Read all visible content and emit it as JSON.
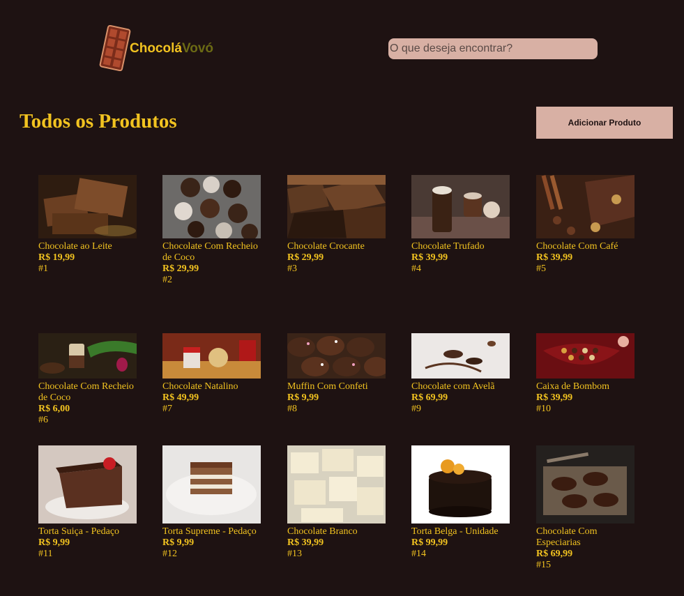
{
  "header": {
    "brand_part1": "Chocolá",
    "brand_part2": "Vovó",
    "search_placeholder": "O que deseja encontrar?"
  },
  "main": {
    "title": "Todos os Produtos",
    "add_button": "Adicionar Produto"
  },
  "products": [
    {
      "name": "Chocolate ao Leite",
      "price": "R$ 19,99",
      "id": "#1"
    },
    {
      "name": "Chocolate Com Recheio de Coco",
      "price": "R$ 29,99",
      "id": "#2"
    },
    {
      "name": "Chocolate Crocante",
      "price": "R$ 29,99",
      "id": "#3"
    },
    {
      "name": "Chocolate Trufado",
      "price": "R$ 39,99",
      "id": "#4"
    },
    {
      "name": "Chocolate Com Café",
      "price": "R$ 39,99",
      "id": "#5"
    },
    {
      "name": "Chocolate Com Recheio de Coco",
      "price": "R$ 6,00",
      "id": "#6"
    },
    {
      "name": "Chocolate Natalino",
      "price": "R$ 49,99",
      "id": "#7"
    },
    {
      "name": "Muffin Com Confeti",
      "price": "R$ 9,99",
      "id": "#8"
    },
    {
      "name": "Chocolate com Avelã",
      "price": "R$ 69,99",
      "id": "#9"
    },
    {
      "name": "Caixa de Bombom",
      "price": "R$ 39,99",
      "id": "#10"
    },
    {
      "name": "Torta Suiça - Pedaço",
      "price": "R$ 9,99",
      "id": "#11"
    },
    {
      "name": "Torta Supreme - Pedaço",
      "price": "R$ 9,99",
      "id": "#12"
    },
    {
      "name": "Chocolate Branco",
      "price": "R$ 39,99",
      "id": "#13"
    },
    {
      "name": "Torta Belga - Unidade",
      "price": "R$ 99,99",
      "id": "#14"
    },
    {
      "name": "Chocolate Com Especiarias",
      "price": "R$ 69,99",
      "id": "#15"
    }
  ],
  "colors": {
    "background": "#1e1212",
    "accent": "#f2c320",
    "button": "#d8b0a4"
  }
}
